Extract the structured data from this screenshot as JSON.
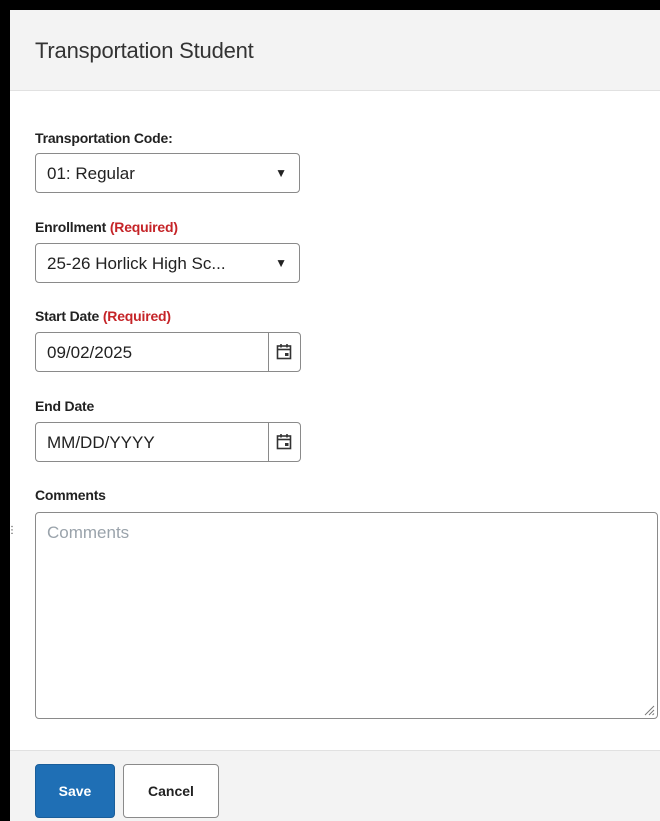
{
  "panel": {
    "title": "Transportation Student"
  },
  "form": {
    "transportation_code": {
      "label": "Transportation Code:",
      "value": "01: Regular"
    },
    "enrollment": {
      "label": "Enrollment",
      "required": "(Required)",
      "value": "25-26 Horlick High Sc..."
    },
    "start_date": {
      "label": "Start Date",
      "required": "(Required)",
      "value": "09/02/2025"
    },
    "end_date": {
      "label": "End Date",
      "placeholder": "MM/DD/YYYY"
    },
    "comments": {
      "label": "Comments",
      "placeholder": "Comments"
    }
  },
  "footer": {
    "save_label": "Save",
    "cancel_label": "Cancel"
  },
  "icons": {
    "caret": "caret-down-icon",
    "calendar": "calendar-icon",
    "resize": "resize-grip-icon"
  },
  "colors": {
    "primary": "#1f6fb5",
    "required": "#c52428",
    "header_bg": "#f3f3f3"
  }
}
